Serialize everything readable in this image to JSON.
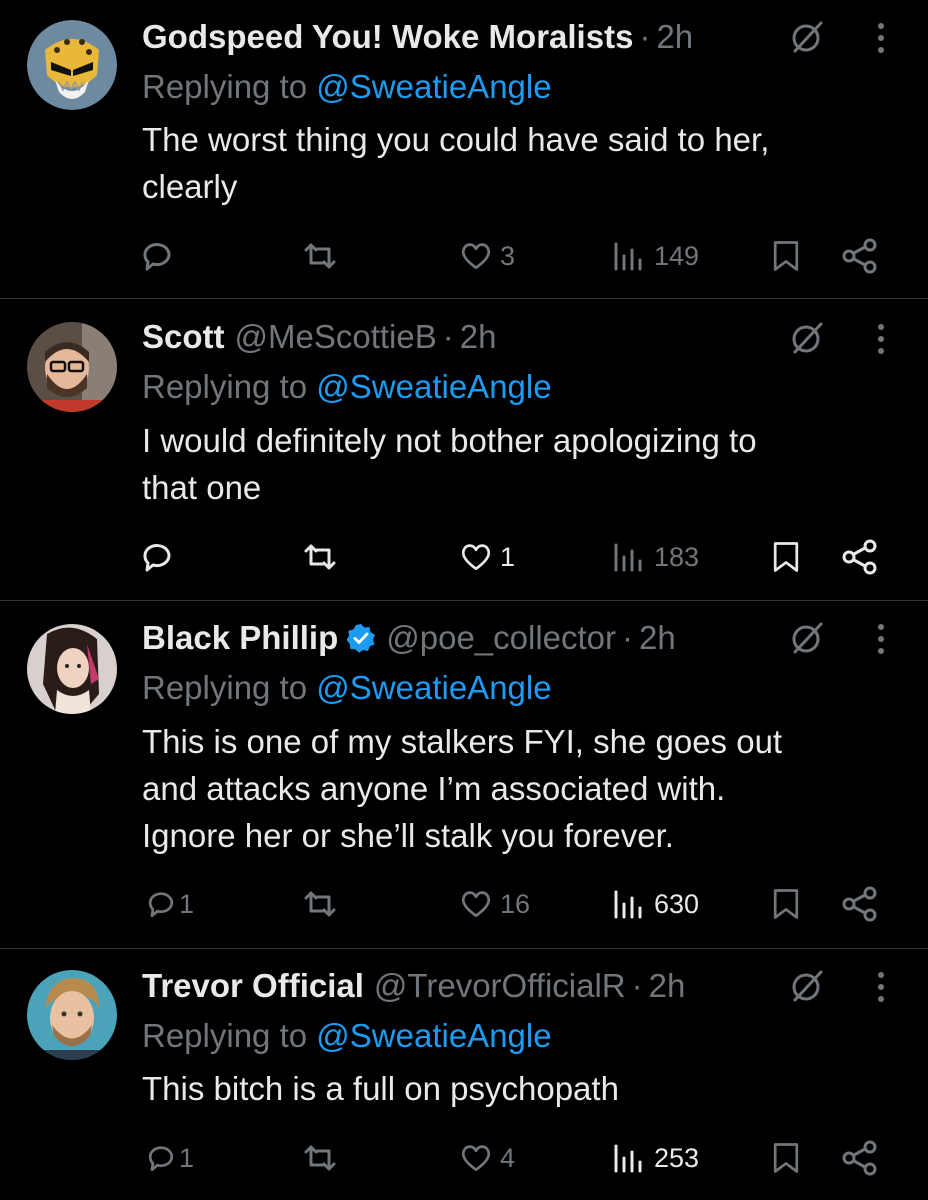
{
  "replying_label": "Replying to",
  "tweets": [
    {
      "name": "Godspeed You! Woke Moralists",
      "handle": "",
      "time": "2h",
      "verified": false,
      "mention": "@SweatieAngle",
      "text_lines": [
        "The worst thing you could have said to her,",
        "clearly"
      ],
      "replies": "",
      "retweets": "",
      "likes": "3",
      "views": "149",
      "avatar": "gold-jaguar-mask"
    },
    {
      "name": "Scott",
      "handle": "@MeScottieB",
      "time": "2h",
      "verified": false,
      "mention": "@SweatieAngle",
      "text_lines": [
        "I would definitely not bother apologizing to",
        "that one"
      ],
      "replies": "",
      "retweets": "",
      "likes": "1",
      "views": "183",
      "avatar": "man-with-glasses"
    },
    {
      "name": "Black Phillip",
      "handle": "@poe_collector",
      "time": "2h",
      "verified": true,
      "mention": "@SweatieAngle",
      "text_lines": [
        "This is one of my stalkers FYI, she goes out",
        "and attacks anyone I’m associated with.",
        "Ignore her or she’ll stalk you forever."
      ],
      "replies": "1",
      "retweets": "",
      "likes": "16",
      "views": "630",
      "avatar": "woman-dark-hair"
    },
    {
      "name": "Trevor Official",
      "handle": "@TrevorOfficialR",
      "time": "2h",
      "verified": false,
      "mention": "@SweatieAngle",
      "text_lines": [
        "This bitch is a full on psychopath"
      ],
      "replies": "1",
      "retweets": "",
      "likes": "4",
      "views": "253",
      "avatar": "young-man-blond"
    }
  ],
  "colors": {
    "background": "#000000",
    "text": "#e7e9ea",
    "muted": "#71767b",
    "link": "#1d9bf0",
    "divider": "#2f3336"
  },
  "icons": [
    "reply-icon",
    "retweet-icon",
    "like-icon",
    "views-icon",
    "bookmark-icon",
    "share-icon",
    "grok-icon",
    "more-icon",
    "verified-icon"
  ]
}
